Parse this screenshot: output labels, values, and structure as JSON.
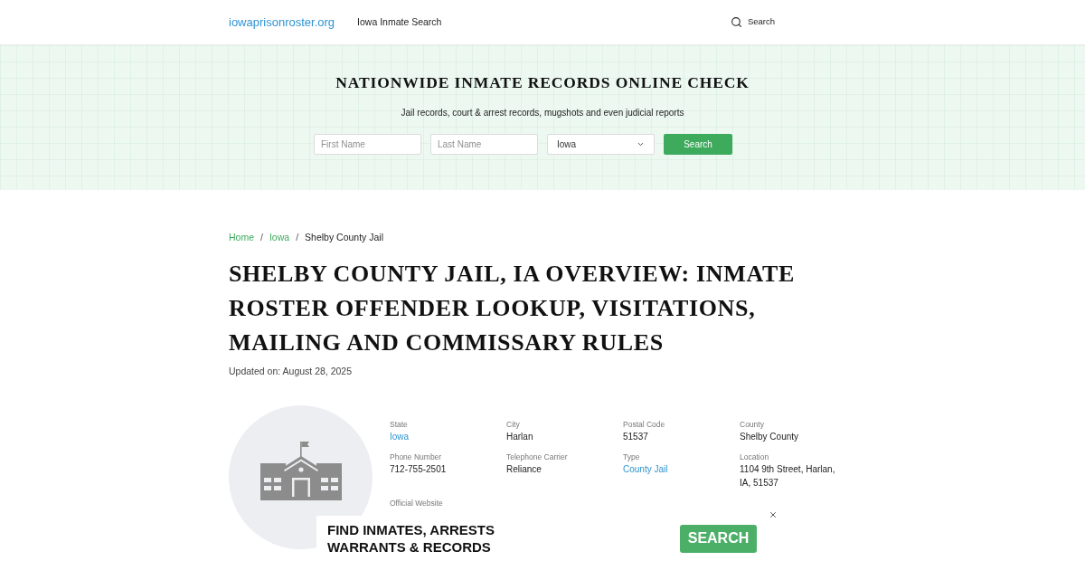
{
  "header": {
    "logo": "iowaprisonroster.org",
    "nav": [
      {
        "label": "Iowa Inmate Search"
      }
    ],
    "search": {
      "label": "Search"
    }
  },
  "hero": {
    "title": "NATIONWIDE INMATE RECORDS ONLINE CHECK",
    "subtitle": "Jail records, court & arrest records, mugshots and even judicial reports",
    "form": {
      "first_name": {
        "placeholder": "First Name"
      },
      "last_name": {
        "placeholder": "Last Name"
      },
      "state": {
        "value": "Iowa"
      },
      "button": "Search"
    }
  },
  "breadcrumb": [
    {
      "label": "Home",
      "kind": "link",
      "separator": "/"
    },
    {
      "label": "Iowa",
      "kind": "link",
      "separator": "/"
    },
    {
      "label": "Shelby County Jail",
      "kind": "current"
    }
  ],
  "page_title": "SHELBY COUNTY JAIL, IA OVERVIEW: INMATE ROSTER OFFENDER LOOKUP, VISITATIONS, MAILING AND COMMISSARY RULES",
  "updated": "Updated on: August 28, 2025",
  "facts": [
    {
      "label": "State",
      "value": "Iowa",
      "kind": "link"
    },
    {
      "label": "City",
      "value": "Harlan",
      "kind": "text"
    },
    {
      "label": "Postal Code",
      "value": "51537",
      "kind": "text"
    },
    {
      "label": "County",
      "value": "Shelby County",
      "kind": "text"
    },
    {
      "label": "Phone Number",
      "value": "712-755-2501",
      "kind": "text"
    },
    {
      "label": "Telephone Carrier",
      "value": "Reliance",
      "kind": "text"
    },
    {
      "label": "Type",
      "value": "County Jail",
      "kind": "link"
    },
    {
      "label": "Location",
      "value": "1104 9th Street, Harlan, IA, 51537",
      "kind": "text"
    },
    {
      "label": "Official Website"
    }
  ],
  "ad": {
    "headline": "FIND INMATES, ARRESTS WARRANTS & RECORDS",
    "button": "SEARCH"
  }
}
